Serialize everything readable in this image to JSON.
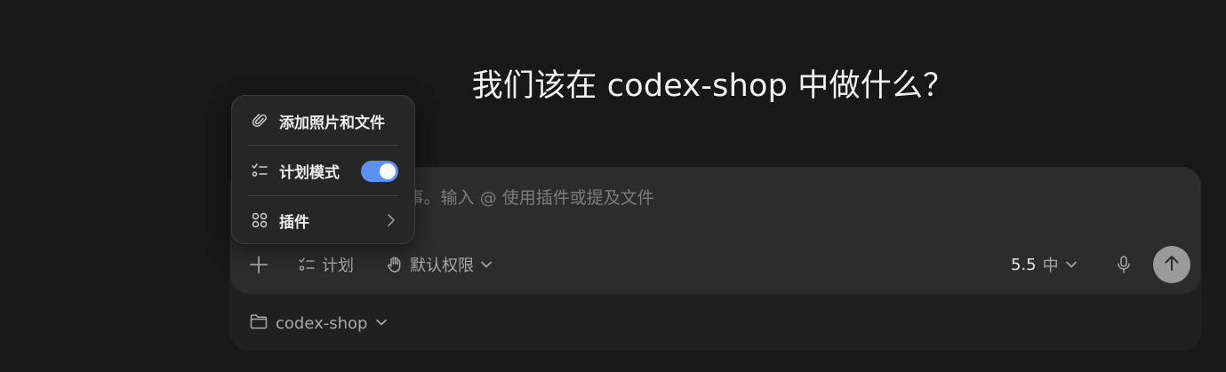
{
  "headline": "我们该在 codex-shop 中做什么？",
  "composer": {
    "placeholder": "要求 Codex 做任何事。输入 @ 使用插件或提及文件",
    "toolbar": {
      "add_icon": "plus-icon",
      "plan_label": "计划",
      "plan_icon": "checklist-icon",
      "permission_label": "默认权限",
      "permission_icon": "hand-icon",
      "model_version": "5.5",
      "model_effort": "中",
      "mic_icon": "microphone-icon",
      "send_icon": "arrow-up-icon"
    }
  },
  "project": {
    "name": "codex-shop",
    "icon": "folder-icon"
  },
  "menu": {
    "items": [
      {
        "label": "添加照片和文件",
        "icon": "paperclip-icon"
      },
      {
        "label": "计划模式",
        "icon": "checklist-icon",
        "toggle_on": true
      },
      {
        "label": "插件",
        "icon": "grid-dots-icon",
        "has_submenu": true
      }
    ]
  },
  "colors": {
    "background": "#181818",
    "composer": "#2c2c2c",
    "menu": "#262626",
    "toggle_on": "#5b8ff0",
    "send_button": "#9a9a9a"
  }
}
